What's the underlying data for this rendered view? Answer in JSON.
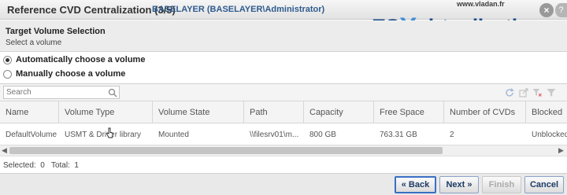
{
  "window": {
    "title": "Reference CVD Centralization (3/5)",
    "user": "BASELAYER (BASELAYER\\Administrator)"
  },
  "watermark": {
    "url": "www.vladan.fr",
    "brand_es": "ES",
    "brand_x": "X",
    "brand_rest": "virtualization"
  },
  "step": {
    "title": "Target Volume Selection",
    "subtitle": "Select a volume"
  },
  "options": [
    {
      "label": "Automatically choose a volume",
      "checked": true
    },
    {
      "label": "Manually choose a volume",
      "checked": false
    }
  ],
  "search": {
    "placeholder": "Search"
  },
  "columns": [
    "Name",
    "Volume Type",
    "Volume State",
    "Path",
    "Capacity",
    "Free Space",
    "Number of CVDs",
    "Blocked"
  ],
  "rows": [
    {
      "name": "DefaultVolume",
      "type": "USMT & Driver library",
      "state": "Mounted",
      "path": "\\\\filesrv01\\m...",
      "capacity": "800 GB",
      "free": "763.31 GB",
      "cvds": "2",
      "blocked": "Unblocked"
    }
  ],
  "status": {
    "text": "Selected:  0   Total:  1"
  },
  "buttons": {
    "back": "« Back",
    "next": "Next »",
    "finish": "Finish",
    "cancel": "Cancel"
  },
  "colors": {
    "accent": "#3a6fc4",
    "title_user": "#2f5b8f"
  }
}
